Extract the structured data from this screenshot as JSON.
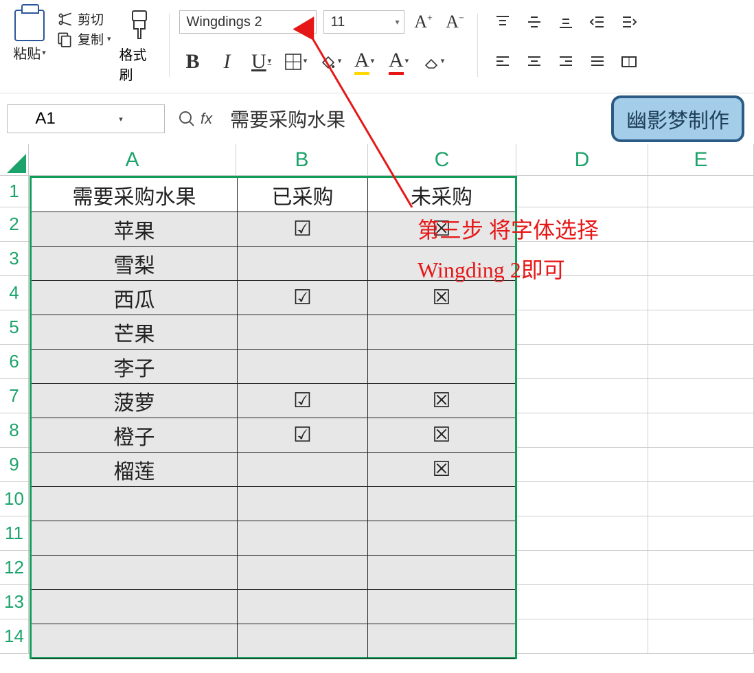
{
  "ribbon": {
    "paste_label": "粘贴",
    "cut_label": "剪切",
    "copy_label": "复制",
    "brush_label": "格式刷",
    "font_name": "Wingdings 2",
    "font_size": "11",
    "increase_font": "A⁺",
    "decrease_font": "A⁻",
    "bold": "B",
    "italic": "I",
    "underline": "U"
  },
  "namebox": {
    "value": "A1"
  },
  "formula_bar": {
    "fx": "fx",
    "value": "需要采购水果"
  },
  "watermark": "幽影梦制作",
  "columns": [
    "A",
    "B",
    "C",
    "D",
    "E"
  ],
  "rows": [
    "1",
    "2",
    "3",
    "4",
    "5",
    "6",
    "7",
    "8",
    "9",
    "10",
    "11",
    "12",
    "13",
    "14"
  ],
  "table": {
    "headers": {
      "A": "需要采购水果",
      "B": "已采购",
      "C": "未采购"
    },
    "data": [
      {
        "A": "苹果",
        "B": "☑",
        "C": "☒"
      },
      {
        "A": "雪梨",
        "B": "",
        "C": ""
      },
      {
        "A": "西瓜",
        "B": "☑",
        "C": "☒"
      },
      {
        "A": "芒果",
        "B": "",
        "C": ""
      },
      {
        "A": "李子",
        "B": "",
        "C": ""
      },
      {
        "A": "菠萝",
        "B": "☑",
        "C": "☒"
      },
      {
        "A": "橙子",
        "B": "☑",
        "C": "☒"
      },
      {
        "A": "榴莲",
        "B": "",
        "C": "☒"
      }
    ]
  },
  "annotation": {
    "line1": "第三步 将字体选择",
    "line2": "Wingding 2即可"
  }
}
